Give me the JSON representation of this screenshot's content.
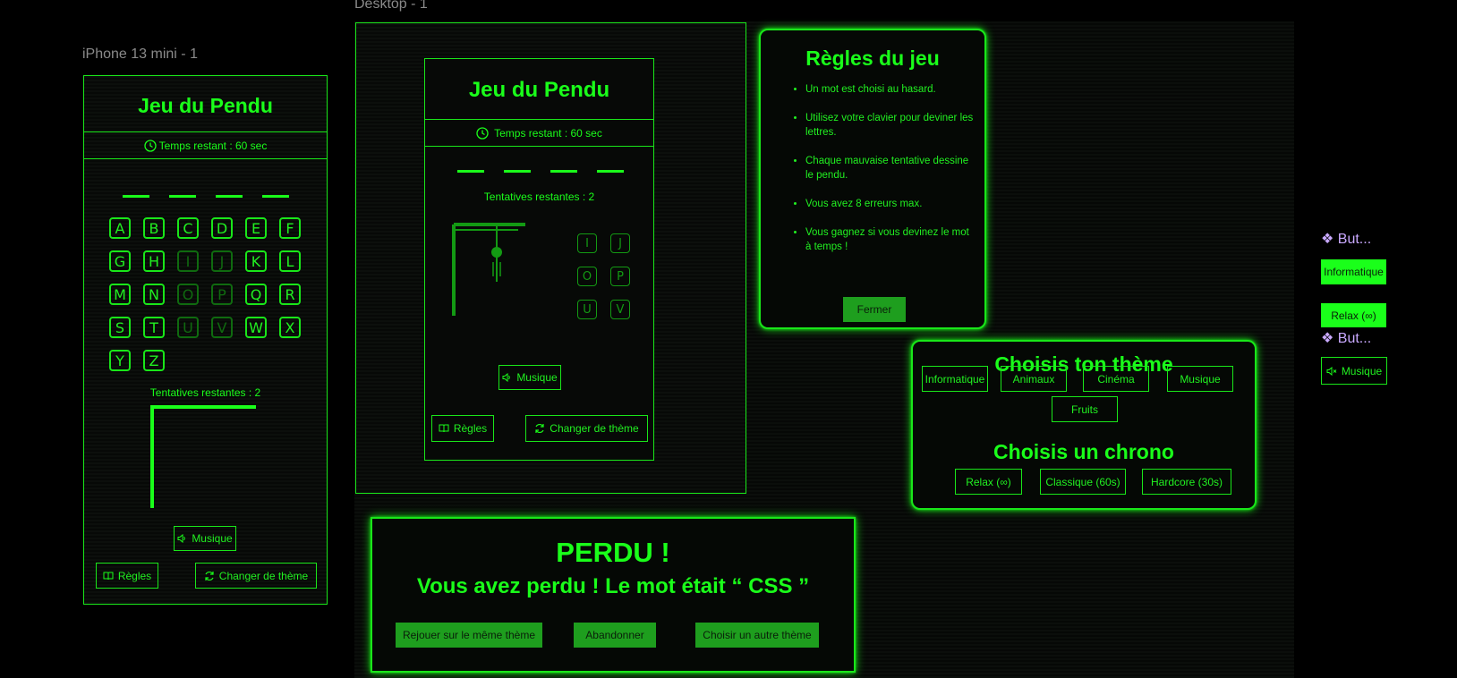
{
  "canvas": {
    "frame_mobile_label": "iPhone 13 mini - 1",
    "frame_desktop_label": "Desktop - 1"
  },
  "mobile": {
    "title": "Jeu du Pendu",
    "timer": "Temps restant : 60 sec",
    "letters": [
      "A",
      "B",
      "C",
      "D",
      "E",
      "F",
      "G",
      "H",
      "I",
      "J",
      "K",
      "L",
      "M",
      "N",
      "O",
      "P",
      "Q",
      "R",
      "S",
      "T",
      "U",
      "V",
      "W",
      "X",
      "Y",
      "Z"
    ],
    "dimmed_letters": [
      "I",
      "J",
      "O",
      "P",
      "U",
      "V"
    ],
    "attempts": "Tentatives restantes : 2",
    "music_label": "Musique",
    "rules_label": "Règles",
    "change_theme_label": "Changer de thème"
  },
  "desktop": {
    "title": "Jeu du Pendu",
    "timer": "Temps restant : 60 sec",
    "attempts": "Tentatives restantes : 2",
    "used_letters": [
      "I",
      "J",
      "O",
      "P",
      "U",
      "V"
    ],
    "music_label": "Musique",
    "rules_label": "Règles",
    "change_theme_label": "Changer de thème"
  },
  "rules_modal": {
    "title": "Règles du jeu",
    "items": [
      "Un mot est choisi au hasard.",
      "Utilisez votre clavier pour deviner les lettres.",
      "Chaque mauvaise tentative dessine le pendu.",
      "Vous avez 8 erreurs max.",
      "Vous gagnez si vous devinez le mot à temps !"
    ],
    "close_label": "Fermer"
  },
  "theme_modal": {
    "theme_title": "Choisis ton thème",
    "themes": [
      "Informatique",
      "Animaux",
      "Cinéma",
      "Musique",
      "Fruits"
    ],
    "chrono_title": "Choisis un chrono",
    "chronos": [
      "Relax (∞)",
      "Classique (60s)",
      "Hardcore (30s)"
    ]
  },
  "lose_modal": {
    "title": "PERDU !",
    "message": "Vous avez perdu ! Le mot était “ CSS ”",
    "replay_label": "Rejouer sur le même thème",
    "abandon_label": "Abandonner",
    "other_theme_label": "Choisir un autre thème"
  },
  "components": {
    "button_label_1": "❖ But...",
    "button_label_2": "❖ But...",
    "informatique_label": "Informatique",
    "relax_label": "Relax (∞)",
    "music_label": "Musique"
  },
  "colors": {
    "accent": "#1aff1a",
    "fill": "#1e9e1e",
    "background": "#000000"
  }
}
